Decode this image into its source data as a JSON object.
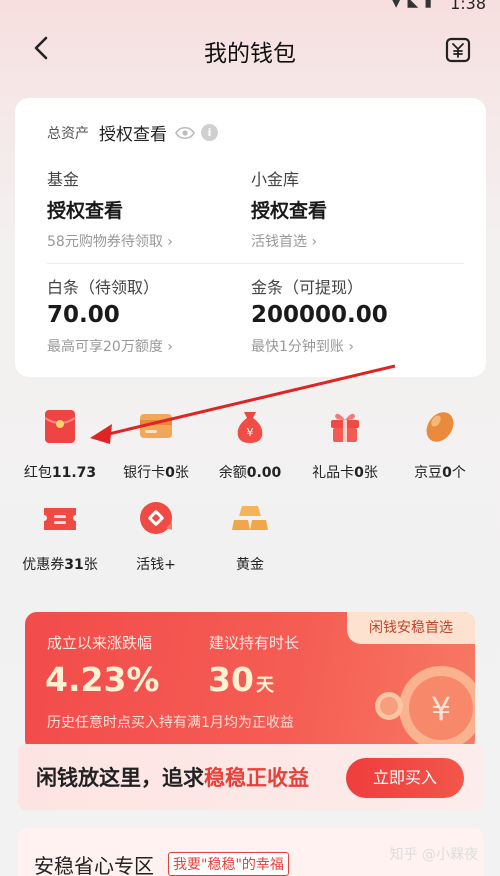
{
  "status": {
    "time": "1:38"
  },
  "nav": {
    "title": "我的钱包"
  },
  "assets": {
    "label": "总资产",
    "value": "授权查看",
    "cells": [
      {
        "label": "基金",
        "value": "授权查看",
        "sub": "58元购物券待领取 ›"
      },
      {
        "label": "小金库",
        "value": "授权查看",
        "sub": "活钱首选 ›"
      },
      {
        "label": "白条（待领取）",
        "value": "70.00",
        "sub": "最高可享20万额度 ›"
      },
      {
        "label": "金条（可提现）",
        "value": "200000.00",
        "sub": "最快1分钟到账 ›"
      }
    ]
  },
  "grid": [
    {
      "name": "红包",
      "count": "11.73",
      "icon": "red-envelope-icon"
    },
    {
      "name": "银行卡",
      "count": "0",
      "suffix": "张",
      "icon": "bank-card-icon"
    },
    {
      "name": "余额",
      "count": "0.00",
      "icon": "money-bag-icon"
    },
    {
      "name": "礼品卡",
      "count": "0",
      "suffix": "张",
      "icon": "gift-icon"
    },
    {
      "name": "京豆",
      "count": "0",
      "suffix": "个",
      "icon": "bean-icon"
    },
    {
      "name": "优惠券",
      "count": "31",
      "suffix": "张",
      "icon": "coupon-icon"
    },
    {
      "name": "活钱+",
      "count": "",
      "icon": "flexible-cash-icon"
    },
    {
      "name": "黄金",
      "count": "",
      "icon": "gold-bars-icon"
    }
  ],
  "promo": {
    "tag": "闲钱安稳首选",
    "label1": "成立以来涨跌幅",
    "label2": "建议持有时长",
    "value1": "4.23%",
    "value2": "30",
    "value2_unit": "天",
    "note": "历史任意时点买入持有满1月均为正收益"
  },
  "cta": {
    "text_prefix": "闲钱放这里，追求",
    "text_highlight": "稳稳正收益",
    "button": "立即买入"
  },
  "section": {
    "title": "安稳省心专区",
    "slogan": "我要\"稳稳\"的幸福"
  },
  "watermark": "知乎 @小槑夜",
  "colors": {
    "accent": "#e8413a",
    "promo": "#f24b4b",
    "gold": "#f2b24c"
  }
}
